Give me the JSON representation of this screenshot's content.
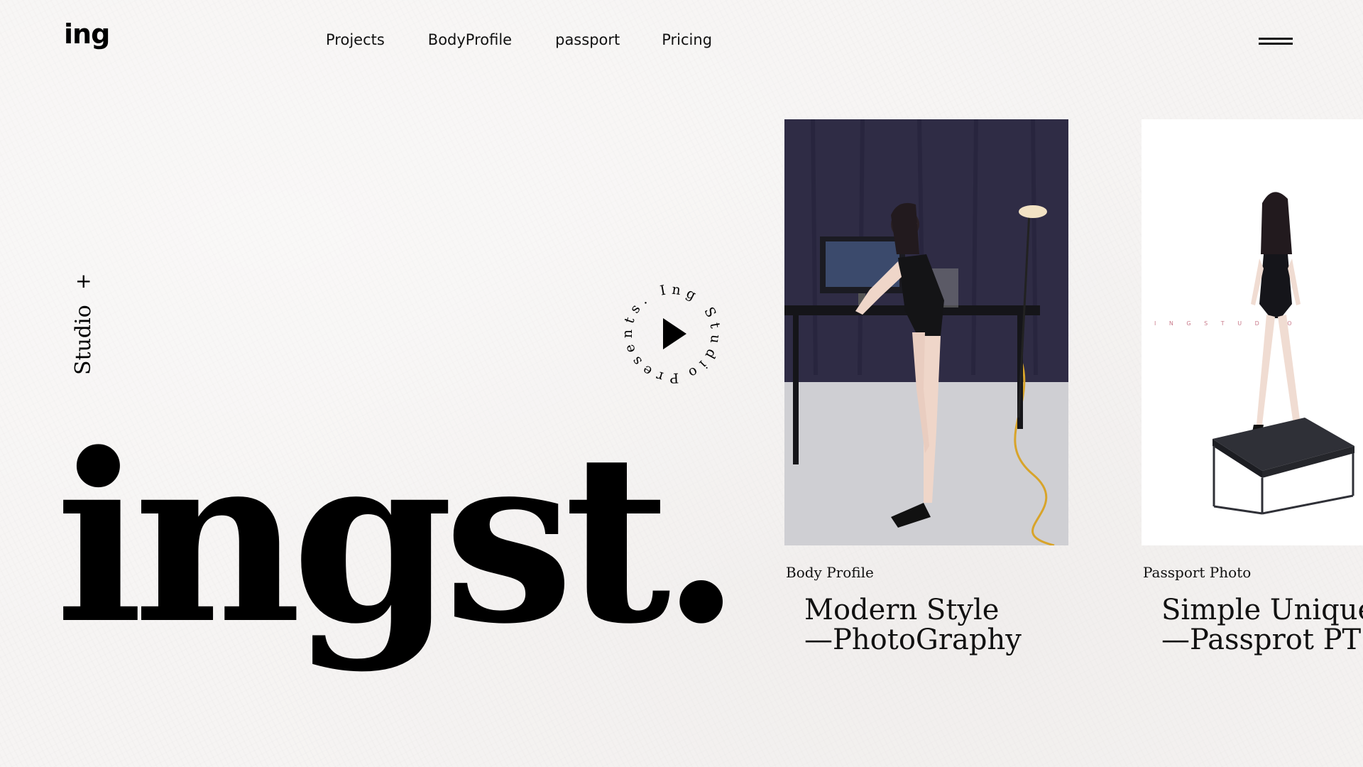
{
  "header": {
    "logo": "ing",
    "nav": [
      {
        "label": "Projects"
      },
      {
        "label": "BodyProfile"
      },
      {
        "label": "passport"
      },
      {
        "label": "Pricing"
      }
    ],
    "menu_icon": "hamburger-icon"
  },
  "side": {
    "label": "Studio",
    "plus": "+"
  },
  "badge": {
    "circle_text": "Presents. Ing Studio",
    "icon": "play-icon"
  },
  "hero": {
    "headline": "ingst."
  },
  "cards": [
    {
      "category": "Body Profile",
      "title_line1": "Modern Style",
      "title_line2": "—PhotoGraphy"
    },
    {
      "category": "Passport Photo",
      "title_line1": "Simple Unique",
      "title_line2": "—Passprot PT",
      "photo_text": "I N G S T U D I O"
    }
  ],
  "colors": {
    "background": "#f6f4f3",
    "text": "#000000",
    "studio_wall": "#2f2c45"
  }
}
